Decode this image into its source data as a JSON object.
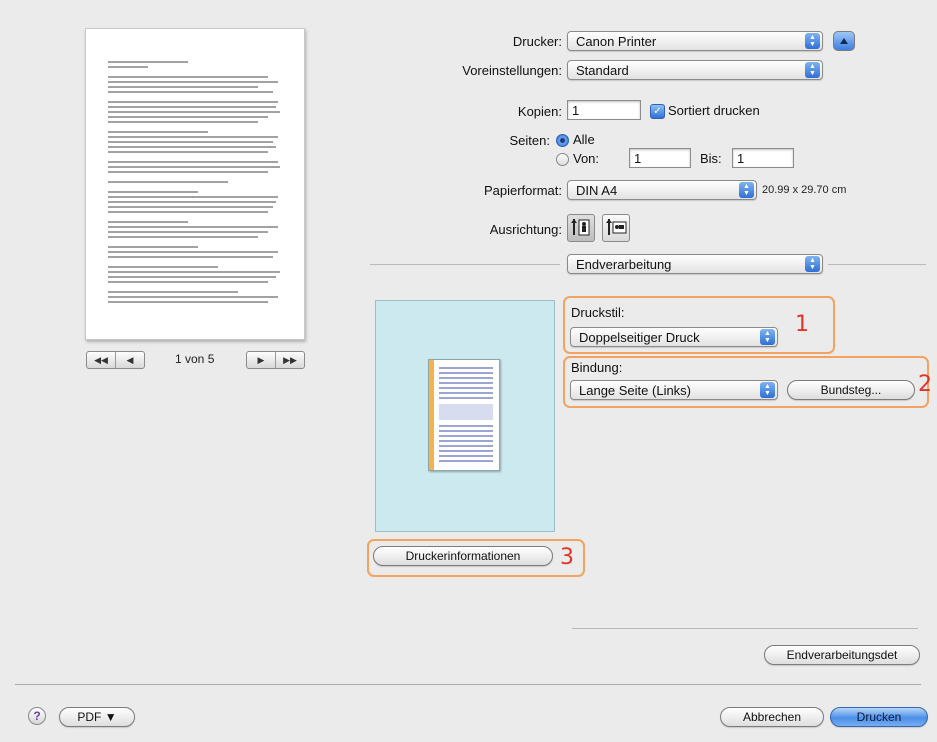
{
  "preview": {
    "page_nav": {
      "first": "◀◀",
      "prev": "◀",
      "next": "▶",
      "last": "▶▶",
      "page_text": "1 von 5"
    }
  },
  "printer": {
    "label": "Drucker:",
    "value": "Canon Printer"
  },
  "presets": {
    "label": "Voreinstellungen:",
    "value": "Standard"
  },
  "copies": {
    "label": "Kopien:",
    "value": "1",
    "collate_label": "Sortiert drucken",
    "collate_checked": true
  },
  "pages": {
    "label": "Seiten:",
    "all_label": "Alle",
    "from_label": "Von:",
    "from_value": "1",
    "to_label": "Bis:",
    "to_value": "1"
  },
  "paper": {
    "label": "Papierformat:",
    "value": "DIN A4",
    "size_text": "20.99 x 29.70 cm"
  },
  "orientation": {
    "label": "Ausrichtung:"
  },
  "panel_selector": {
    "value": "Endverarbeitung"
  },
  "print_style": {
    "label": "Druckstil:",
    "value": "Doppelseitiger Druck",
    "callout": "1"
  },
  "binding": {
    "label": "Bindung:",
    "value": "Lange Seite (Links)",
    "gutter_button": "Bundsteg...",
    "callout": "2"
  },
  "printer_info": {
    "button": "Druckerinformationen",
    "callout": "3"
  },
  "finishing_details": {
    "button": "Endverarbeitungsdet"
  },
  "footer": {
    "help": "?",
    "pdf": "PDF ▼",
    "cancel": "Abbrechen",
    "print": "Drucken"
  },
  "colors": {
    "callout_border": "#f2a35f",
    "callout_text": "#e0342a",
    "preview_bg": "#cde9f0",
    "binding_edge": "#f6b14c"
  }
}
